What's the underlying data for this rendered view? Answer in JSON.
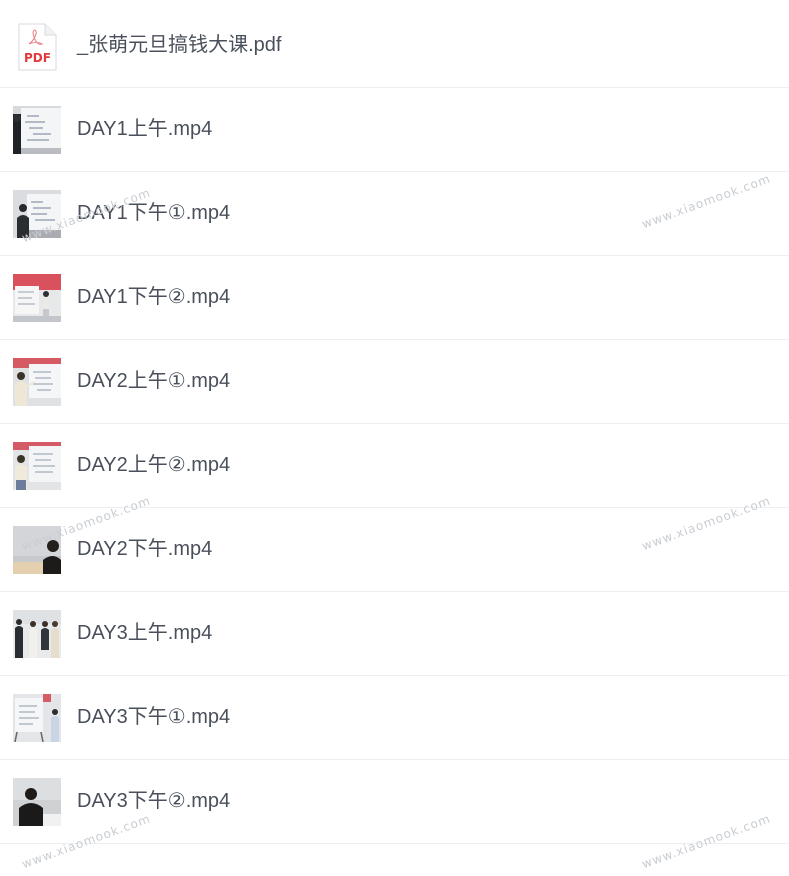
{
  "files": [
    {
      "name": "_张萌元旦搞钱大课.pdf",
      "type": "pdf",
      "icon": "pdf-file-icon",
      "icon_label": "PDF"
    },
    {
      "name": "DAY1上午.mp4",
      "type": "video",
      "icon": "video-thumbnail-icon"
    },
    {
      "name": "DAY1下午①.mp4",
      "type": "video",
      "icon": "video-thumbnail-icon"
    },
    {
      "name": "DAY1下午②.mp4",
      "type": "video",
      "icon": "video-thumbnail-icon"
    },
    {
      "name": "DAY2上午①.mp4",
      "type": "video",
      "icon": "video-thumbnail-icon"
    },
    {
      "name": "DAY2上午②.mp4",
      "type": "video",
      "icon": "video-thumbnail-icon"
    },
    {
      "name": "DAY2下午.mp4",
      "type": "video",
      "icon": "video-thumbnail-icon"
    },
    {
      "name": "DAY3上午.mp4",
      "type": "video",
      "icon": "video-thumbnail-icon"
    },
    {
      "name": "DAY3下午①.mp4",
      "type": "video",
      "icon": "video-thumbnail-icon"
    },
    {
      "name": "DAY3下午②.mp4",
      "type": "video",
      "icon": "video-thumbnail-icon"
    }
  ],
  "watermark": "www.xiaomook.com",
  "colors": {
    "pdf_red": "#e2393f",
    "text": "#4a505b",
    "divider": "#eceef1",
    "watermark": "#c9cdd3"
  }
}
